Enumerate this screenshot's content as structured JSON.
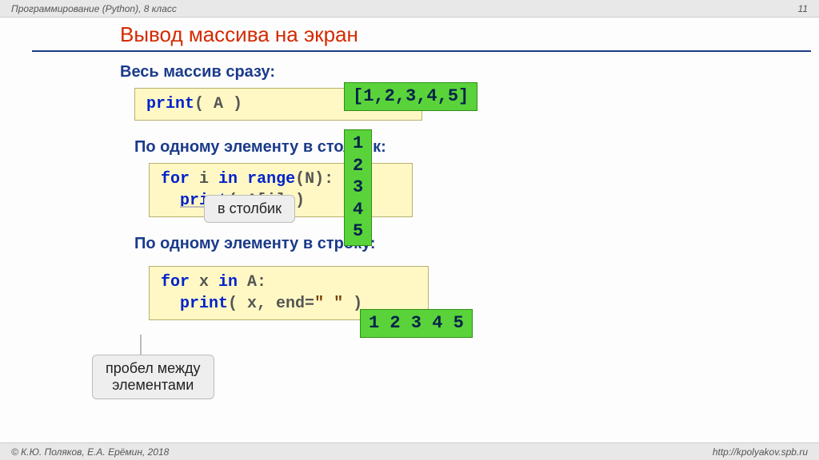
{
  "header": {
    "left": "Программирование (Python), 8 класс",
    "page": "11"
  },
  "footer": {
    "left": "© К.Ю. Поляков, Е.А. Ерёмин, 2018",
    "right": "http://kpolyakov.spb.ru"
  },
  "title": "Вывод массива на экран",
  "sections": {
    "whole": "Весь массив сразу:",
    "column": "По одному элементу в столбик:",
    "row": "По одному элементу в строку:"
  },
  "code": {
    "c1_print": "print",
    "c1_rest": "( A )",
    "c2_for": "for",
    "c2_in": "in",
    "c2_range": "range",
    "c2_i": " i ",
    "c2_parenN": "(N):",
    "c2_line2_print": "print",
    "c2_line2_rest": "( A[i] )",
    "c3_for": "for",
    "c3_x": " x ",
    "c3_in": "in",
    "c3_A": " A:",
    "c3_line2_print": "print",
    "c3_line2_mid": "( x, end=",
    "c3_line2_str": "\" \"",
    "c3_line2_end": " )"
  },
  "outputs": {
    "whole": "[1,2,3,4,5]",
    "column": "1\n2\n3\n4\n5",
    "row": "1 2 3 4 5"
  },
  "callouts": {
    "column": "в столбик",
    "space": "пробел между\nэлементами"
  }
}
